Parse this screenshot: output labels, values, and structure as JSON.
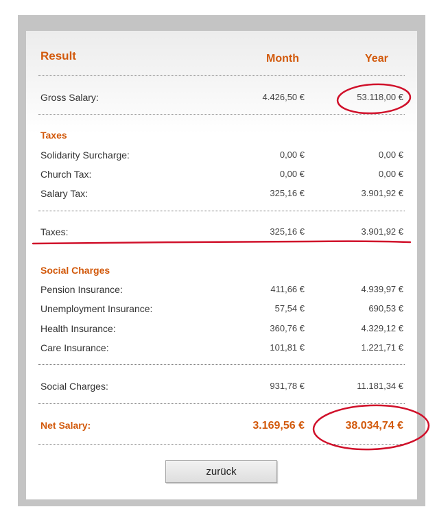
{
  "header": {
    "title": "Result",
    "month_label": "Month",
    "year_label": "Year"
  },
  "gross": {
    "label": "Gross Salary:",
    "month": "4.426,50 €",
    "year": "53.118,00 €"
  },
  "taxes_section": {
    "heading": "Taxes",
    "rows": [
      {
        "label": "Solidarity Surcharge:",
        "month": "0,00 €",
        "year": "0,00 €"
      },
      {
        "label": "Church Tax:",
        "month": "0,00 €",
        "year": "0,00 €"
      },
      {
        "label": "Salary Tax:",
        "month": "325,16 €",
        "year": "3.901,92 €"
      }
    ],
    "total": {
      "label": "Taxes:",
      "month": "325,16 €",
      "year": "3.901,92 €"
    }
  },
  "social_section": {
    "heading": "Social Charges",
    "rows": [
      {
        "label": "Pension Insurance:",
        "month": "411,66 €",
        "year": "4.939,97 €"
      },
      {
        "label": "Unemployment Insurance:",
        "month": "57,54 €",
        "year": "690,53 €"
      },
      {
        "label": "Health Insurance:",
        "month": "360,76 €",
        "year": "4.329,12 €"
      },
      {
        "label": "Care Insurance:",
        "month": "101,81 €",
        "year": "1.221,71 €"
      }
    ],
    "total": {
      "label": "Social Charges:",
      "month": "931,78 €",
      "year": "11.181,34 €"
    }
  },
  "net": {
    "label": "Net Salary:",
    "month": "3.169,56 €",
    "year": "38.034,74 €"
  },
  "back_button": {
    "label": "zurück"
  },
  "colors": {
    "accent": "#d2590b",
    "annotation": "#d0102a",
    "frame": "#c4c4c4"
  }
}
